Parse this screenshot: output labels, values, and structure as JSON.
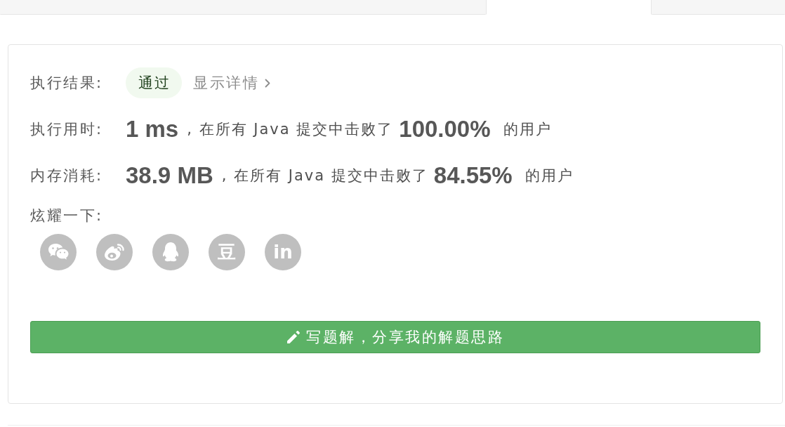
{
  "tabs": [
    {
      "selected": false
    },
    {
      "selected": true
    },
    {
      "selected": false
    }
  ],
  "result": {
    "label": "执行结果:",
    "status": "通过",
    "details_link": "显示详情"
  },
  "stats": [
    {
      "label": "执行用时:",
      "value": "1 ms",
      "comparison": ", 在所有 Java 提交中击败了",
      "percent": "100.00%",
      "suffix": "的用户"
    },
    {
      "label": "内存消耗:",
      "value": "38.9 MB",
      "comparison": ", 在所有 Java 提交中击败了",
      "percent": "84.55%",
      "suffix": "的用户"
    }
  ],
  "share": {
    "label": "炫耀一下:",
    "buttons": [
      {
        "kind": "bubbles"
      },
      {
        "kind": "swirl"
      },
      {
        "kind": "penguin"
      },
      {
        "kind": "glyph",
        "glyph": "豆"
      },
      {
        "kind": "glyph",
        "glyph": "in"
      }
    ]
  },
  "write_solution_button": {
    "label": "写题解，分享我的解题思路"
  }
}
